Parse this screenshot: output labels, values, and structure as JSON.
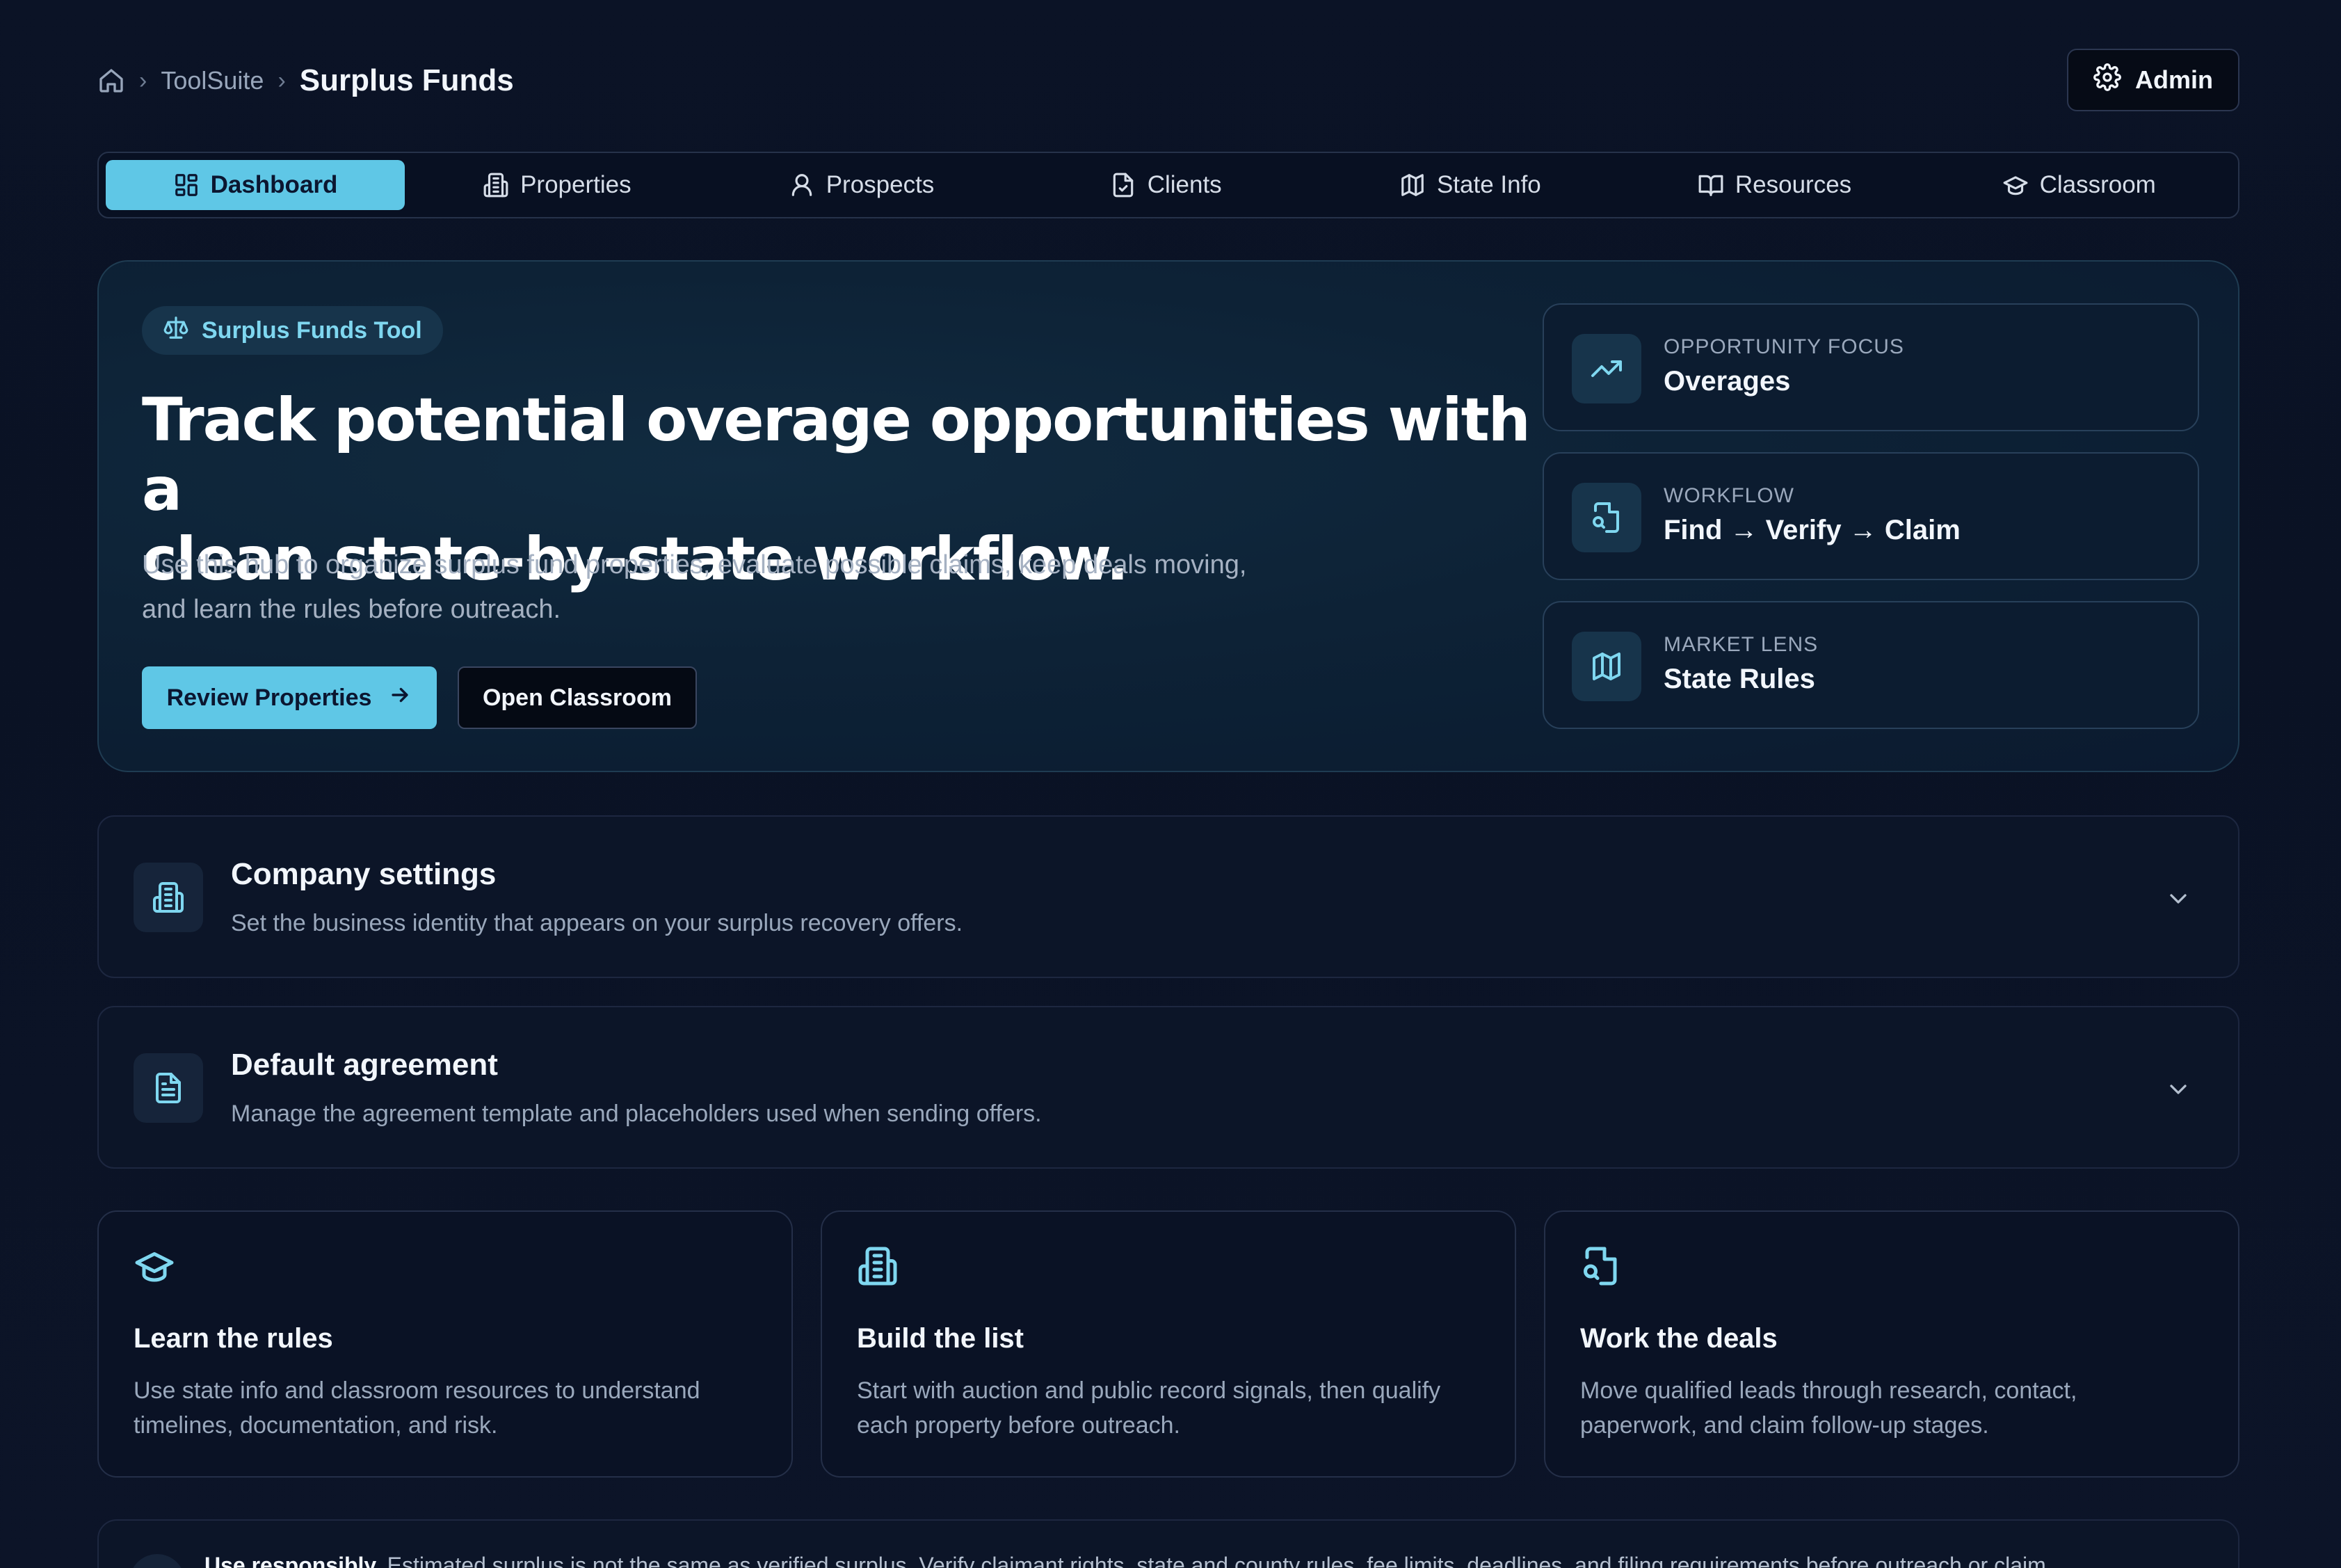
{
  "breadcrumb": {
    "items": [
      {
        "label": "ToolSuite"
      },
      {
        "label": "Surplus Funds"
      }
    ]
  },
  "admin_label": "Admin",
  "tabs": [
    {
      "label": "Dashboard",
      "icon": "grid-icon",
      "active": true
    },
    {
      "label": "Properties",
      "icon": "building-icon"
    },
    {
      "label": "Prospects",
      "icon": "user-icon"
    },
    {
      "label": "Clients",
      "icon": "file-check-icon"
    },
    {
      "label": "State Info",
      "icon": "map-icon"
    },
    {
      "label": "Resources",
      "icon": "book-open-icon"
    },
    {
      "label": "Classroom",
      "icon": "graduation-cap-icon"
    }
  ],
  "hero": {
    "badge": "Surplus Funds Tool",
    "title_line1": "Track potential overage opportunities with a",
    "title_line2": "clean state-by-state workflow.",
    "description_line1": "Use this hub to organize surplus fund properties, evaluate possible claims, keep deals moving,",
    "description_line2": "and learn the rules before outreach.",
    "primary_cta": "Review Properties",
    "secondary_cta": "Open Classroom"
  },
  "stats": [
    {
      "label": "OPPORTUNITY FOCUS",
      "value": "Overages",
      "icon": "trending-up-icon"
    },
    {
      "label": "WORKFLOW",
      "value": "Find → Verify → Claim",
      "icon": "file-search-icon"
    },
    {
      "label": "MARKET LENS",
      "value": "State Rules",
      "icon": "map-icon"
    }
  ],
  "accordions": [
    {
      "title": "Company settings",
      "subtitle": "Set the business identity that appears on your surplus recovery offers.",
      "icon": "building-icon"
    },
    {
      "title": "Default agreement",
      "subtitle": "Manage the agreement template and placeholders used when sending offers.",
      "icon": "document-icon"
    }
  ],
  "cards": [
    {
      "title": "Learn the rules",
      "desc_line1": "Use state info and classroom resources to understand",
      "desc_line2": "timelines, documentation, and risk.",
      "icon": "graduation-cap-icon"
    },
    {
      "title": "Build the list",
      "desc_line1": "Start with auction and public record signals, then qualify",
      "desc_line2": "each property before outreach.",
      "icon": "building-icon"
    },
    {
      "title": "Work the deals",
      "desc_line1": "Move qualified leads through research, contact,",
      "desc_line2": "paperwork, and claim follow-up stages.",
      "icon": "file-search-icon"
    }
  ],
  "notice": {
    "lead": "Use responsibly.",
    "text": "Estimated surplus is not the same as verified surplus. Verify claimant rights, state and county rules, fee limits, deadlines, and filing requirements before outreach or claim"
  },
  "colors": {
    "accent": "#5fc7e6",
    "background": "#0b1326",
    "card_border": "#242f48"
  }
}
